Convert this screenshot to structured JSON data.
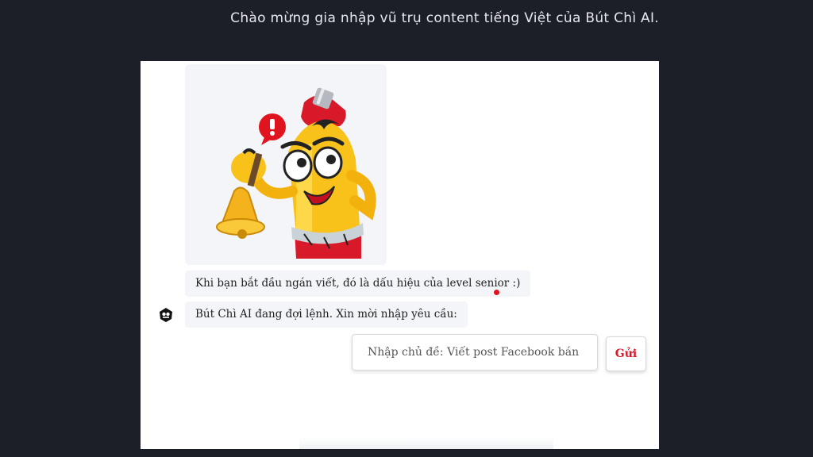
{
  "header": {
    "welcome_text": "Chào mừng gia nhập vũ trụ content tiếng Việt của Bút Chì AI."
  },
  "chat": {
    "messages": [
      {
        "text": "Khi bạn bắt đầu ngán viết, đó là dấu hiệu của level senior :)"
      },
      {
        "text": "Bút Chì AI đang đợi lệnh. Xin mời nhập yêu cầu:"
      }
    ],
    "mascot_icon": "pencil-mascot-ringing-bell-icon",
    "bot_icon": "bot-badge-icon"
  },
  "composer": {
    "placeholder": "Nhập chủ đề: Viết post Facebook bán hàng",
    "value": "",
    "send_label": "Gửi"
  },
  "colors": {
    "background": "#1c1e28",
    "panel": "#ffffff",
    "bubble": "#f4f5f9",
    "accent_red": "#d8192a"
  }
}
